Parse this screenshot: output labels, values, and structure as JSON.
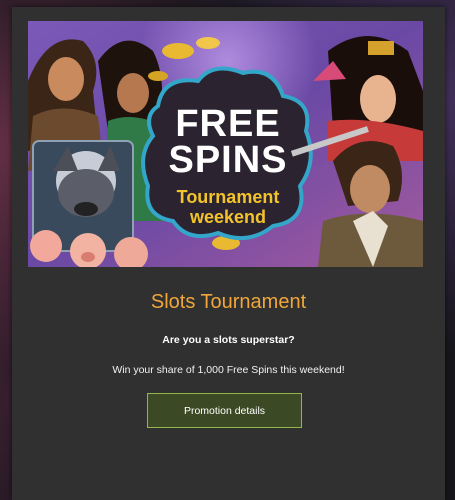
{
  "banner": {
    "headline_line1": "FREE",
    "headline_line2": "SPINS",
    "sub_line1": "Tournament",
    "sub_line2": "weekend",
    "colors": {
      "sky": "#6a49a5",
      "cloud": "#2b2430",
      "cloud_outline": "#33a6c9",
      "headline": "#ffffff",
      "sub": "#f2c32b"
    }
  },
  "promo": {
    "title": "Slots Tournament",
    "subtitle": "Are you a slots superstar?",
    "description": "Win your share of 1,000 Free Spins this weekend!",
    "button_label": "Promotion details"
  },
  "colors": {
    "modal_bg": "#303030",
    "title": "#f0a63a",
    "button_bg": "#3b4a24",
    "button_border": "#93b54a"
  }
}
